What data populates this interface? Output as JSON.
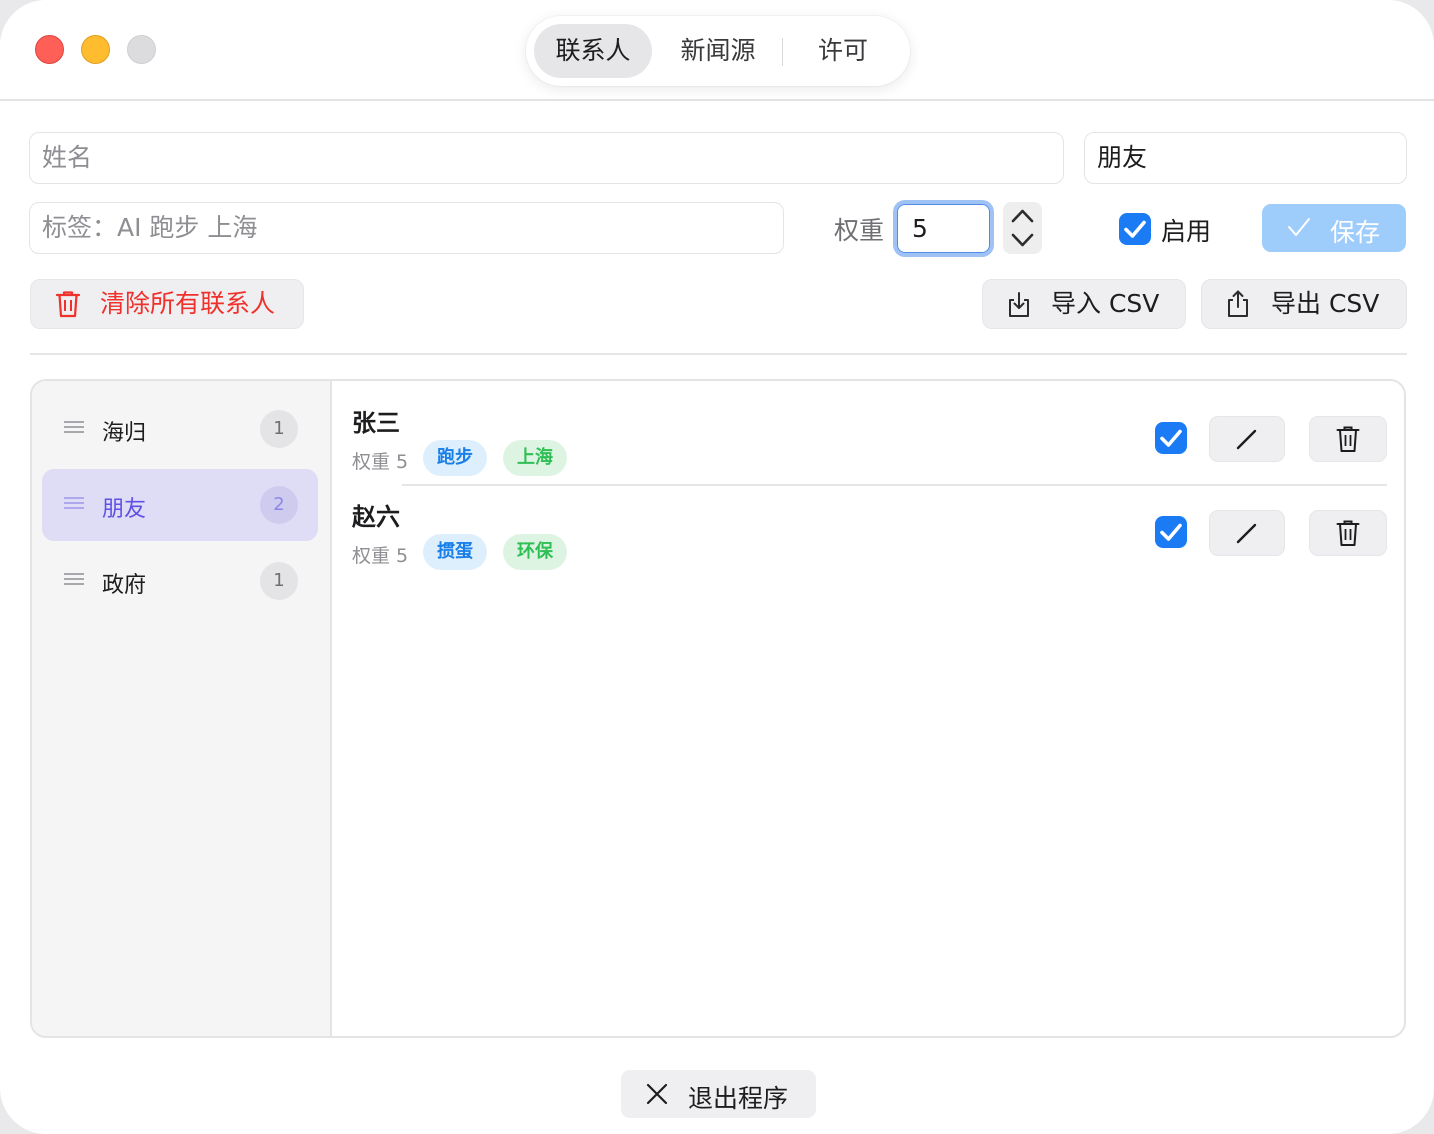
{
  "tabs": [
    {
      "label": "联系人",
      "active": true
    },
    {
      "label": "新闻源",
      "active": false
    },
    {
      "label": "许可",
      "active": false
    }
  ],
  "form": {
    "name_placeholder": "姓名",
    "group_value": "朋友",
    "tags_placeholder": "标签：AI 跑步 上海",
    "weight_label": "权重",
    "weight_value": "5",
    "enable_label": "启用",
    "enable_checked": true,
    "save_label": "保存"
  },
  "actions": {
    "clear_all_label": "清除所有联系人",
    "import_label": "导入 CSV",
    "export_label": "导出 CSV"
  },
  "groups": [
    {
      "name": "海归",
      "count": "1",
      "active": false
    },
    {
      "name": "朋友",
      "count": "2",
      "active": true
    },
    {
      "name": "政府",
      "count": "1",
      "active": false
    }
  ],
  "contacts": [
    {
      "name": "张三",
      "weight": "权重 5",
      "tags": [
        "跑步",
        "上海"
      ],
      "enabled": true
    },
    {
      "name": "赵六",
      "weight": "权重 5",
      "tags": [
        "掼蛋",
        "环保"
      ],
      "enabled": true
    }
  ],
  "footer": {
    "quit_label": "退出程序"
  },
  "colors": {
    "accent": "#1a7bf5",
    "danger": "#f0302b",
    "group_active_bg": "#dfdcf6",
    "group_active_text": "#5f50e6",
    "tag_blue": "#1a7fe8",
    "tag_green": "#2fbf54"
  },
  "icons": {
    "clear_all": "trash-icon",
    "import": "import-icon",
    "export": "share-icon",
    "quit": "close-icon",
    "edit": "pencil-icon",
    "delete": "trash-icon",
    "drag": "drag-handle-icon"
  }
}
